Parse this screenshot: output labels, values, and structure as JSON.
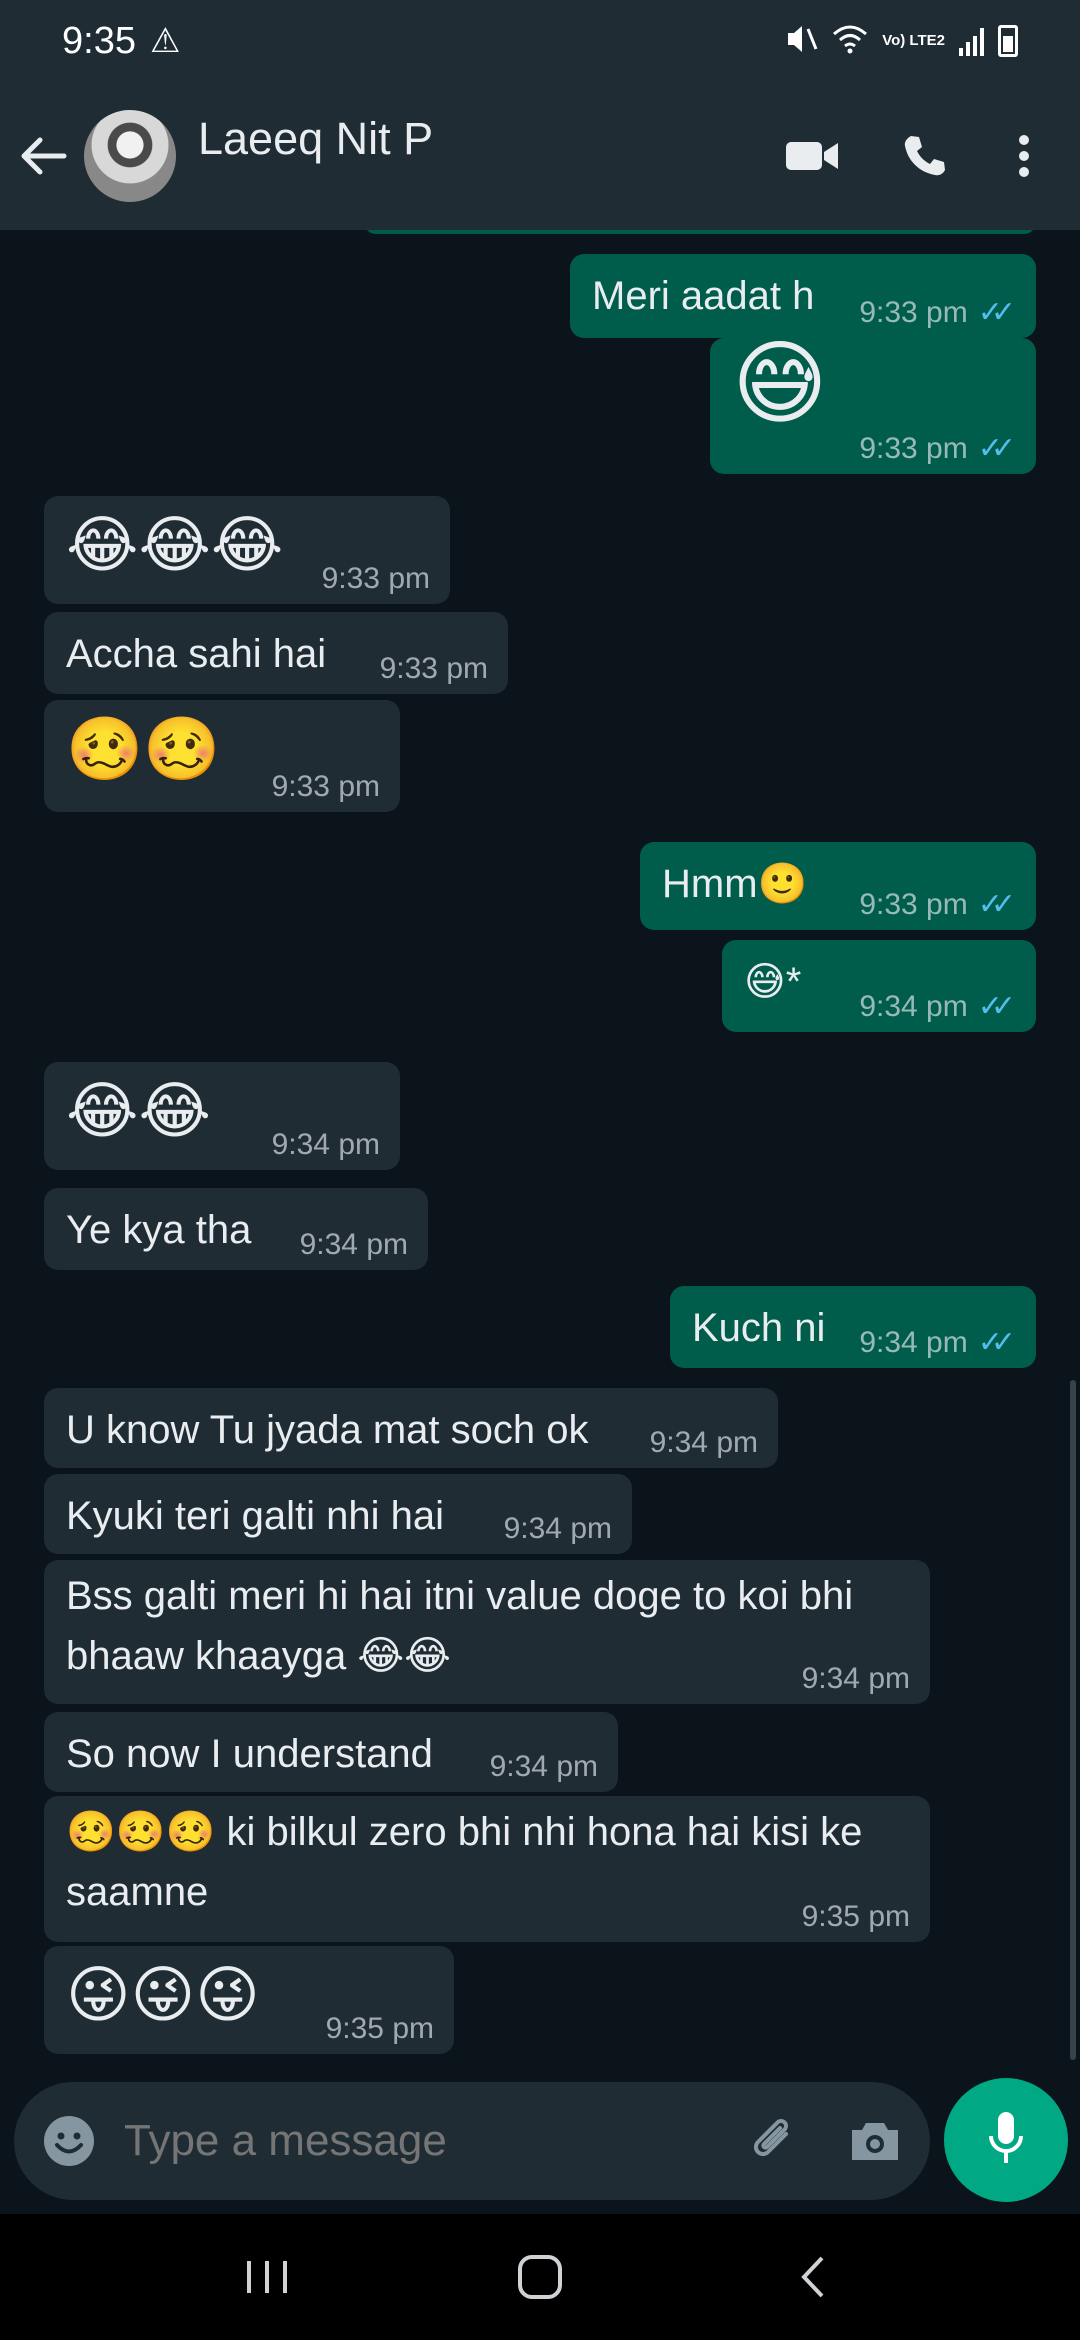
{
  "status_bar": {
    "time": "9:35",
    "warning_icon": "warning-triangle-icon",
    "network": "Vo) LTE2"
  },
  "header": {
    "contact_name": "Laeeq Nit P"
  },
  "messages": [
    {
      "dir": "out",
      "text": "Meri aadat h",
      "time": "9:33 pm"
    },
    {
      "dir": "out",
      "text": "😅",
      "time": "9:33 pm"
    },
    {
      "dir": "in",
      "text": "😂😂😂",
      "time": "9:33 pm"
    },
    {
      "dir": "in",
      "text": "Accha sahi hai",
      "time": "9:33 pm"
    },
    {
      "dir": "in",
      "text": "🥴🥴",
      "time": "9:33 pm"
    },
    {
      "dir": "out",
      "text": "Hmm🙂",
      "time": "9:33 pm"
    },
    {
      "dir": "out",
      "text": "😅*",
      "time": "9:34 pm"
    },
    {
      "dir": "in",
      "text": "😂😂",
      "time": "9:34 pm"
    },
    {
      "dir": "in",
      "text": "Ye kya tha",
      "time": "9:34 pm"
    },
    {
      "dir": "out",
      "text": "Kuch ni",
      "time": "9:34 pm"
    },
    {
      "dir": "in",
      "text": "U know Tu jyada mat soch ok",
      "time": "9:34 pm"
    },
    {
      "dir": "in",
      "text": "Kyuki teri galti nhi hai",
      "time": "9:34 pm"
    },
    {
      "dir": "in",
      "text": "Bss galti meri hi hai itni value doge to koi bhi bhaaw khaayga 😂😂",
      "time": "9:34 pm"
    },
    {
      "dir": "in",
      "text": "So now I understand",
      "time": "9:34 pm"
    },
    {
      "dir": "in",
      "text": "🥴🥴🥴 ki bilkul zero bhi nhi hona hai kisi ke saamne",
      "time": "9:35 pm"
    },
    {
      "dir": "in",
      "text": "😜😜😜",
      "time": "9:35 pm"
    }
  ],
  "read_ticks": "✓✓",
  "input": {
    "placeholder": "Type a message"
  },
  "colors": {
    "header": "#1f2c34",
    "background": "#0b141a",
    "incoming": "#1f2c34",
    "outgoing": "#005c4b",
    "accent": "#00a884",
    "ticks": "#53bdeb"
  }
}
